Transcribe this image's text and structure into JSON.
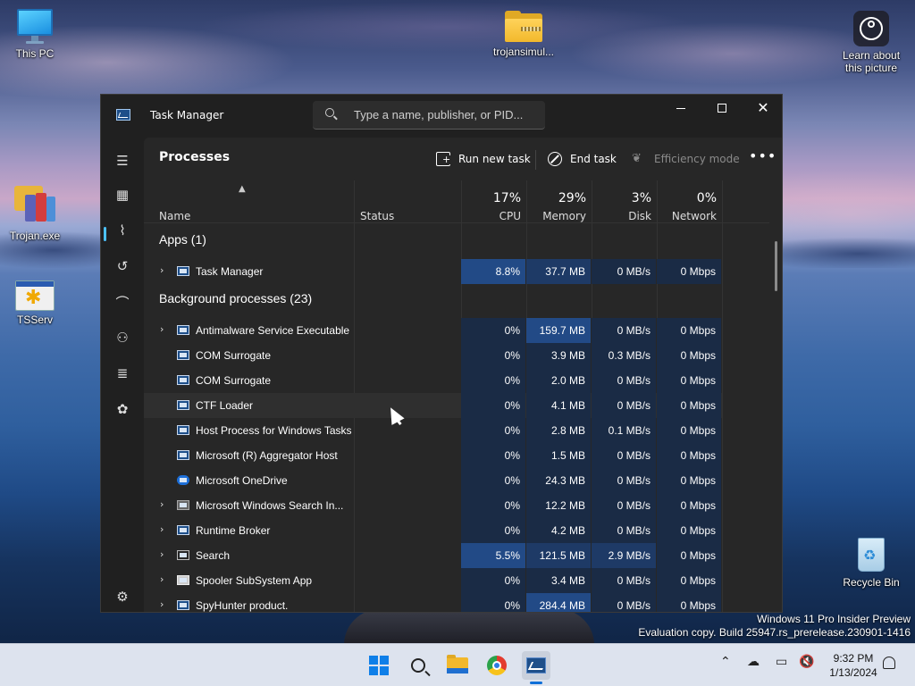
{
  "desktop": {
    "icons": [
      {
        "label": "This PC",
        "icon": "pc-icon"
      },
      {
        "label": "trojansimul...",
        "icon": "zip-folder-icon"
      },
      {
        "label": "Learn about this picture",
        "icon": "learn-icon"
      },
      {
        "label": "Trojan.exe",
        "icon": "trojan-icon"
      },
      {
        "label": "TSServ",
        "icon": "tsserv-icon"
      },
      {
        "label": "Recycle Bin",
        "icon": "recycle-bin-icon"
      }
    ],
    "watermark": {
      "line1": "Windows 11 Pro Insider Preview",
      "line2": "Evaluation copy. Build 25947.rs_prerelease.230901-1416"
    }
  },
  "window": {
    "title": "Task Manager",
    "search_placeholder": "Type a name, publisher, or PID...",
    "controls": {
      "minimize": "—",
      "maximize": "☐",
      "close": "✕"
    }
  },
  "toolbar": {
    "page_title": "Processes",
    "run_new_task": "Run new task",
    "end_task": "End task",
    "efficiency_mode": "Efficiency mode",
    "more": "•••"
  },
  "table": {
    "columns": {
      "name": "Name",
      "status": "Status",
      "cpu_pct": "17%",
      "cpu": "CPU",
      "memory_pct": "29%",
      "memory": "Memory",
      "disk_pct": "3%",
      "disk": "Disk",
      "network_pct": "0%",
      "network": "Network"
    },
    "groups": {
      "apps": "Apps (1)",
      "background": "Background processes (23)"
    },
    "apps": [
      {
        "name": "Task Manager",
        "cpu": "8.8%",
        "memory": "37.7 MB",
        "disk": "0 MB/s",
        "network": "0 Mbps",
        "expandable": true
      }
    ],
    "background": [
      {
        "name": "Antimalware Service Executable",
        "cpu": "0%",
        "memory": "159.7 MB",
        "disk": "0 MB/s",
        "network": "0 Mbps",
        "expandable": true
      },
      {
        "name": "COM Surrogate",
        "cpu": "0%",
        "memory": "3.9 MB",
        "disk": "0.3 MB/s",
        "network": "0 Mbps",
        "expandable": false
      },
      {
        "name": "COM Surrogate",
        "cpu": "0%",
        "memory": "2.0 MB",
        "disk": "0 MB/s",
        "network": "0 Mbps",
        "expandable": false
      },
      {
        "name": "CTF Loader",
        "cpu": "0%",
        "memory": "4.1 MB",
        "disk": "0 MB/s",
        "network": "0 Mbps",
        "expandable": false
      },
      {
        "name": "Host Process for Windows Tasks",
        "cpu": "0%",
        "memory": "2.8 MB",
        "disk": "0.1 MB/s",
        "network": "0 Mbps",
        "expandable": false
      },
      {
        "name": "Microsoft (R) Aggregator Host",
        "cpu": "0%",
        "memory": "1.5 MB",
        "disk": "0 MB/s",
        "network": "0 Mbps",
        "expandable": false
      },
      {
        "name": "Microsoft OneDrive",
        "cpu": "0%",
        "memory": "24.3 MB",
        "disk": "0 MB/s",
        "network": "0 Mbps",
        "expandable": false
      },
      {
        "name": "Microsoft Windows Search In...",
        "cpu": "0%",
        "memory": "12.2 MB",
        "disk": "0 MB/s",
        "network": "0 Mbps",
        "expandable": true
      },
      {
        "name": "Runtime Broker",
        "cpu": "0%",
        "memory": "4.2 MB",
        "disk": "0 MB/s",
        "network": "0 Mbps",
        "expandable": true
      },
      {
        "name": "Search",
        "cpu": "5.5%",
        "memory": "121.5 MB",
        "disk": "2.9 MB/s",
        "network": "0 Mbps",
        "expandable": true
      },
      {
        "name": "Spooler SubSystem App",
        "cpu": "0%",
        "memory": "3.4 MB",
        "disk": "0 MB/s",
        "network": "0 Mbps",
        "expandable": true
      },
      {
        "name": "SpyHunter product.",
        "cpu": "0%",
        "memory": "284.4 MB",
        "disk": "0 MB/s",
        "network": "0 Mbps",
        "expandable": true
      }
    ]
  },
  "taskbar": {
    "clock_time": "9:32 PM",
    "clock_date": "1/13/2024"
  }
}
